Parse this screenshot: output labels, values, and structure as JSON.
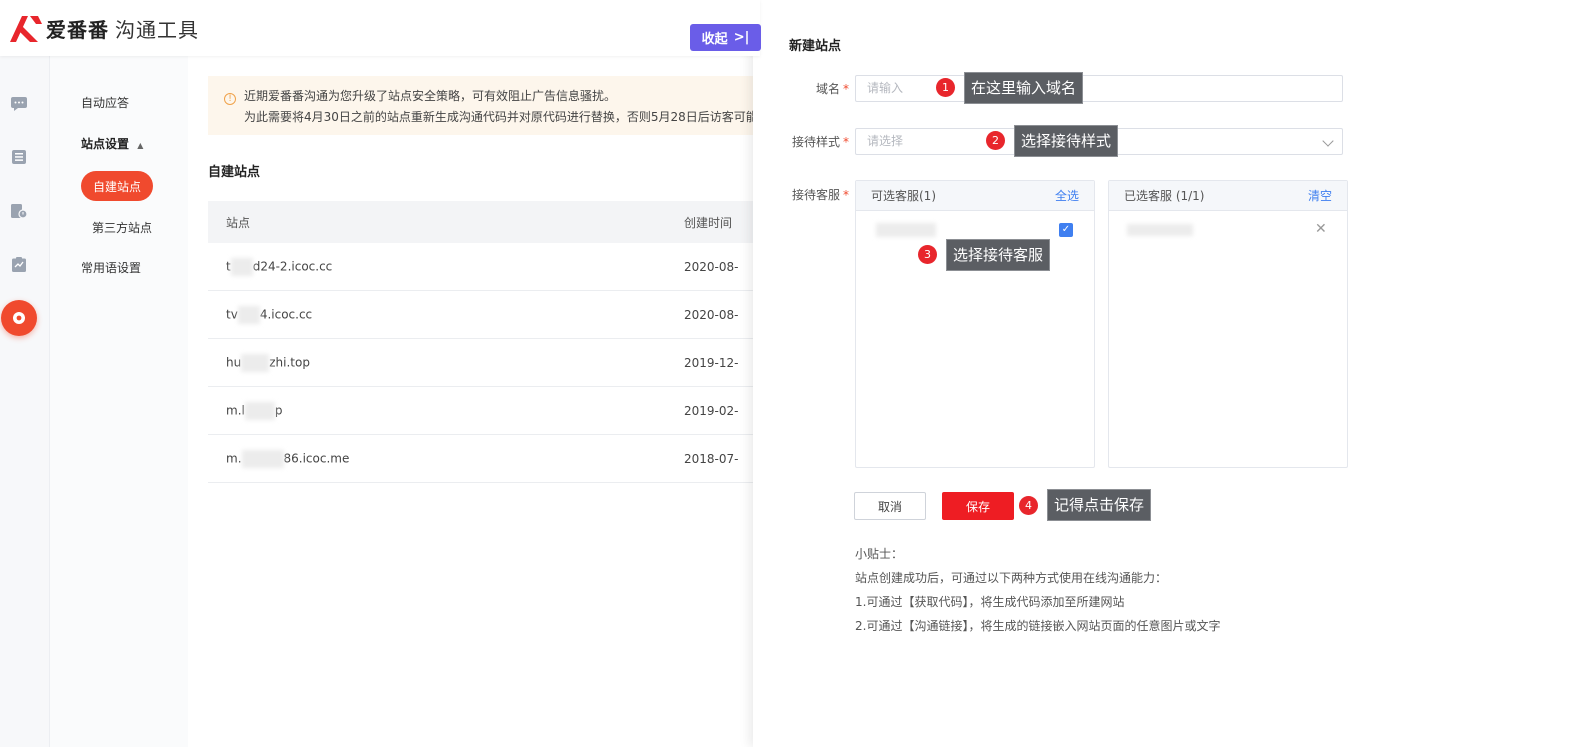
{
  "app": {
    "brand": "爱番番",
    "product": "沟通工具",
    "collapse_label": "收起"
  },
  "rail": {
    "icons": [
      "chat-icon",
      "list-icon",
      "document-clock-icon",
      "clipboard-icon",
      "site-icon"
    ]
  },
  "subnav": {
    "auto_reply": "自动应答",
    "site_settings": "站点设置",
    "self_built": "自建站点",
    "third_party": "第三方站点",
    "phrases": "常用语设置"
  },
  "notice": {
    "line1": "近期爱番番沟通为您升级了站点安全策略，可有效阻止广告信息骚扰。",
    "line2": "为此需要将4月30日之前的站点重新生成沟通代码并对原代码进行替换，否则5月28日后访客可能"
  },
  "main": {
    "section_title": "自建站点"
  },
  "table": {
    "headers": [
      "站点",
      "创建时间"
    ],
    "rows": [
      {
        "site_a": "t",
        "site_b": "d24-2.icoc.cc",
        "date": "2020-08-"
      },
      {
        "site_a": "tv",
        "site_b": "4.icoc.cc",
        "date": "2020-08-"
      },
      {
        "site_a": "hu",
        "site_b": "zhi.top",
        "date": "2019-12-"
      },
      {
        "site_a": "m.l",
        "site_b": "p",
        "date": "2019-02-"
      },
      {
        "site_a": "m.",
        "site_b": "86.icoc.me",
        "date": "2018-07-"
      }
    ]
  },
  "drawer": {
    "title": "新建站点",
    "domain_label": "域名",
    "domain_placeholder": "请输入",
    "style_label": "接待样式",
    "style_placeholder": "请选择",
    "agent_label": "接待客服",
    "required_mark": "*",
    "available_title": "可选客服(1)",
    "select_all": "全选",
    "selected_title": "已选客服 (1/1)",
    "clear": "清空",
    "cancel": "取消",
    "save": "保存",
    "tips": {
      "title": "小贴士：",
      "line1": "站点创建成功后，可通过以下两种方式使用在线沟通能力：",
      "line2": "1.可通过【获取代码】，将生成代码添加至所建网站",
      "line3": "2.可通过【沟通链接】，将生成的链接嵌入网站页面的任意图片或文字"
    }
  },
  "annotations": [
    {
      "num": "1",
      "text": "在这里输入域名"
    },
    {
      "num": "2",
      "text": "选择接待样式"
    },
    {
      "num": "3",
      "text": "选择接待客服"
    },
    {
      "num": "4",
      "text": "记得点击保存"
    }
  ],
  "colors": {
    "accent": "#f04a2e",
    "button_purple": "#6a5de8",
    "save_red": "#ee1d23",
    "link_blue": "#3f7ff0"
  }
}
